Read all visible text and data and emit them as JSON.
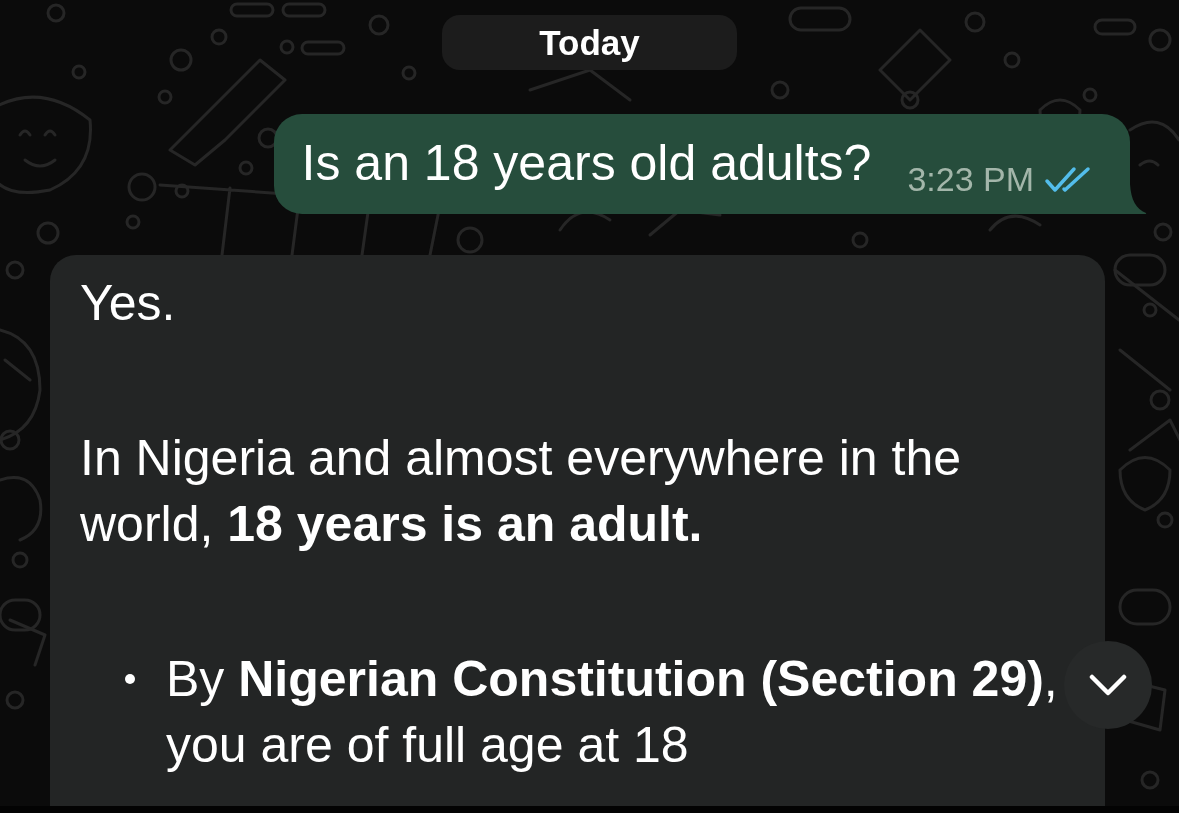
{
  "date_separator": {
    "label": "Today"
  },
  "messages": [
    {
      "kind": "sent",
      "text": "Is an 18 years old adults?",
      "time": "3:23 PM",
      "read": true
    },
    {
      "kind": "received",
      "blocks": [
        {
          "kind": "paragraph",
          "text": "Yes."
        },
        {
          "kind": "paragraph",
          "text": "In Nigeria and almost everywhere in the world, **18 years is an adult.**"
        },
        {
          "kind": "bullet",
          "text": "By **Nigerian Constitution (Section 29)**, you are of full age at 18"
        }
      ]
    }
  ]
}
